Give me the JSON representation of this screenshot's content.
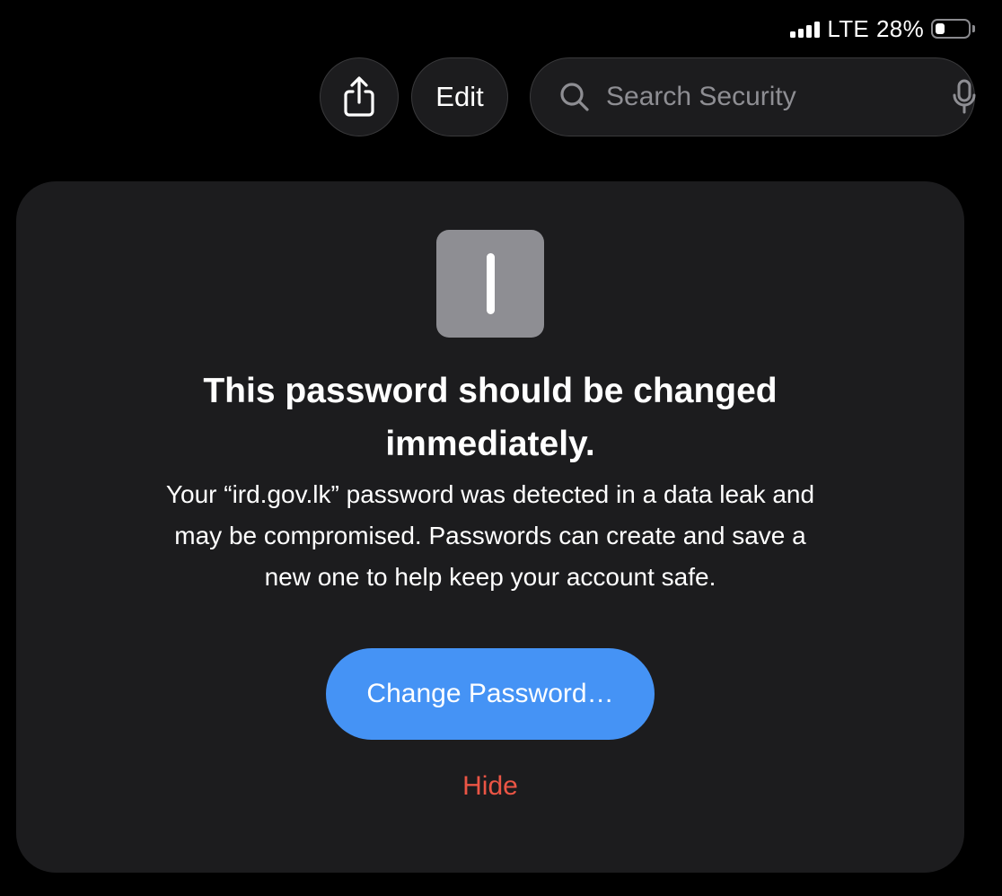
{
  "status_bar": {
    "network": "LTE",
    "battery_percent_label": "28%",
    "battery_level": 0.28,
    "signal_bars": 4
  },
  "toolbar": {
    "share_icon": "share-icon",
    "edit_label": "Edit",
    "search": {
      "placeholder": "Search Security",
      "value": "",
      "icon": "search-icon",
      "mic_icon": "microphone-icon"
    }
  },
  "alert_card": {
    "icon": "key-icon",
    "title": "This password should be changed immediately.",
    "body": "Your “ird.gov.lk” password was detected in a data leak and may be compromised. Passwords can create and save a new one to help keep your account safe.",
    "primary_button_label": "Change Password…",
    "secondary_link_label": "Hide"
  },
  "colors": {
    "background": "#000000",
    "card": "#1c1c1e",
    "accent_blue": "#4593f5",
    "destructive_red": "#eb5545",
    "placeholder_gray": "#8e8e93"
  }
}
